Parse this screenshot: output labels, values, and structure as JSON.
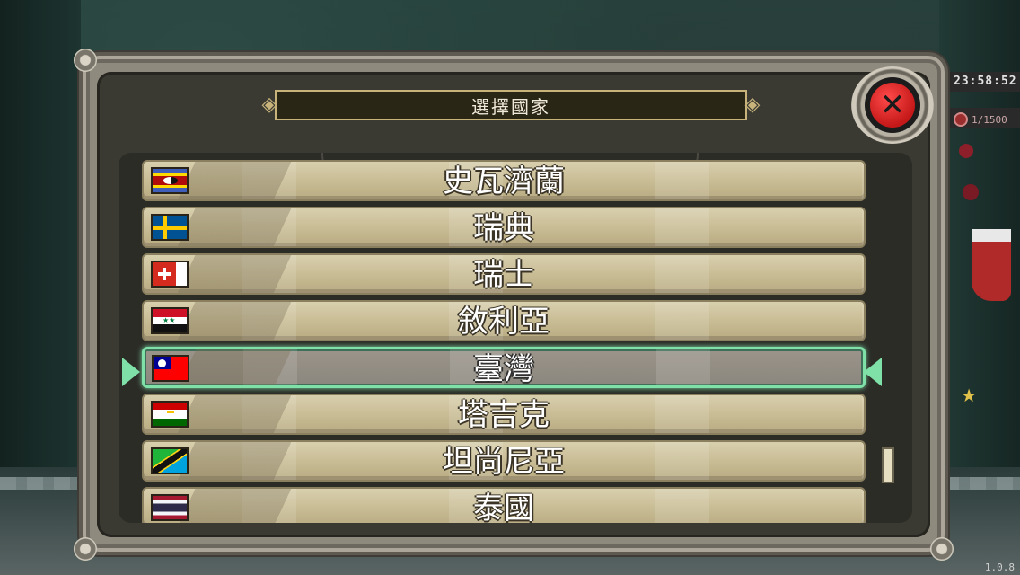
{
  "dialog": {
    "title": "選擇國家",
    "close_icon": "x-icon"
  },
  "hud": {
    "time": "23:58:52",
    "count": "1/1500",
    "version": "1.0.8"
  },
  "countries": [
    {
      "name": "史瓦濟蘭",
      "flag": "eswatini-flag-icon"
    },
    {
      "name": "瑞典",
      "flag": "sweden-flag-icon"
    },
    {
      "name": "瑞士",
      "flag": "switzerland-flag-icon"
    },
    {
      "name": "敘利亞",
      "flag": "syria-flag-icon"
    },
    {
      "name": "臺灣",
      "flag": "taiwan-flag-icon",
      "selected": true
    },
    {
      "name": "塔吉克",
      "flag": "tajikistan-flag-icon"
    },
    {
      "name": "坦尚尼亞",
      "flag": "tanzania-flag-icon"
    },
    {
      "name": "泰國",
      "flag": "thailand-flag-icon"
    }
  ],
  "colors": {
    "selection_glow": "#7fe0a8",
    "row_bg": "#c9bd95",
    "close_red": "#d01f1f"
  }
}
